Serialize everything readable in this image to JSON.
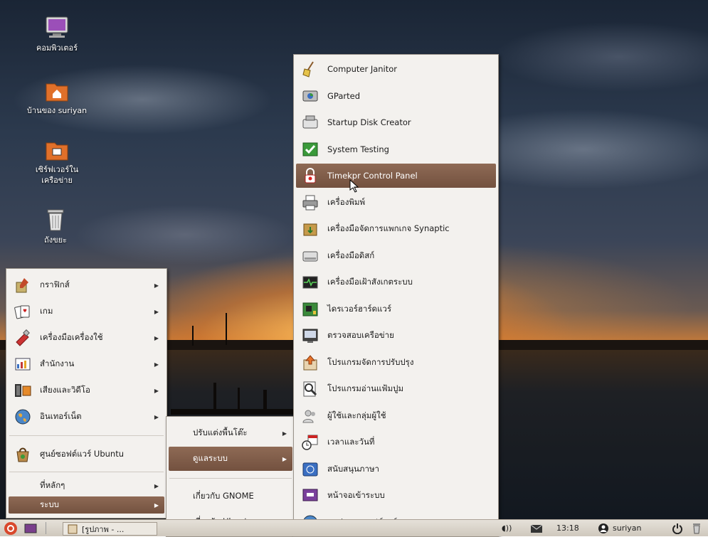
{
  "desktop": {
    "icons": [
      {
        "label": "คอมพิวเตอร์",
        "icon": "computer-icon"
      },
      {
        "label": "บ้านของ suriyan",
        "icon": "home-folder-icon"
      },
      {
        "label": "เซิร์ฟเวอร์ใน\nเครือข่าย",
        "icon": "network-folder-icon"
      },
      {
        "label": "ถังขยะ",
        "icon": "trash-icon"
      }
    ]
  },
  "main_menu": {
    "items": [
      {
        "label": "กราฟิกส์",
        "icon": "graphics-icon"
      },
      {
        "label": "เกม",
        "icon": "games-icon"
      },
      {
        "label": "เครื่องมือเครื่องใช้",
        "icon": "accessories-icon"
      },
      {
        "label": "สำนักงาน",
        "icon": "office-icon"
      },
      {
        "label": "เสียงและวิดีโอ",
        "icon": "sound-video-icon"
      },
      {
        "label": "อินเทอร์เน็ต",
        "icon": "internet-icon"
      },
      {
        "label": "ศูนย์ซอฟต์แวร์ Ubuntu",
        "icon": "software-center-icon"
      },
      {
        "label": "ที่หลักๆ",
        "icon": "places-icon"
      },
      {
        "label": "ระบบ",
        "icon": "system-icon",
        "selected": true
      }
    ]
  },
  "system_menu": {
    "items": [
      {
        "label": "ปรับแต่งพื้นโต๊ะ"
      },
      {
        "label": "ดูแลระบบ",
        "selected": true
      },
      {
        "label": "เกี่ยวกับ GNOME"
      },
      {
        "label": "เกี่ยวกับ Ubuntu"
      }
    ]
  },
  "admin_menu": {
    "items": [
      {
        "label": "Computer Janitor",
        "icon": "broom-icon"
      },
      {
        "label": "GParted",
        "icon": "disk-partition-icon"
      },
      {
        "label": "Startup Disk Creator",
        "icon": "usb-drive-icon"
      },
      {
        "label": "System Testing",
        "icon": "checkmark-icon"
      },
      {
        "label": "Timekpr Control Panel",
        "icon": "padlock-icon",
        "selected": true
      },
      {
        "label": "เครื่องพิมพ์",
        "icon": "printer-icon"
      },
      {
        "label": "เครื่องมือจัดการแพกเกจ Synaptic",
        "icon": "package-icon"
      },
      {
        "label": "เครื่องมือดิสก์",
        "icon": "harddisk-icon"
      },
      {
        "label": "เครื่องมือเฝ้าสังเกตระบบ",
        "icon": "system-monitor-icon"
      },
      {
        "label": "ไดรเวอร์ฮาร์ดแวร์",
        "icon": "hardware-card-icon"
      },
      {
        "label": "ตรวจสอบเครือข่าย",
        "icon": "network-tools-icon"
      },
      {
        "label": "โปรแกรมจัดการปรับปรุง",
        "icon": "update-manager-icon"
      },
      {
        "label": "โปรแกรมอ่านแฟ้มปูม",
        "icon": "log-viewer-icon"
      },
      {
        "label": "ผู้ใช้และกลุ่มผู้ใช้",
        "icon": "users-icon"
      },
      {
        "label": "เวลาและวันที่",
        "icon": "clock-calendar-icon"
      },
      {
        "label": "สนับสนุนภาษา",
        "icon": "language-icon"
      },
      {
        "label": "หน้าจอเข้าระบบ",
        "icon": "login-screen-icon"
      },
      {
        "label": "แหล่งของซอฟต์แวร์",
        "icon": "software-sources-icon"
      }
    ]
  },
  "panel": {
    "taskbar_item": "[รูปภาพ - ...",
    "clock": "13:18",
    "user": "suriyan"
  },
  "colors": {
    "highlight": "#7f5c49",
    "menu_bg": "#f3f1ee"
  }
}
